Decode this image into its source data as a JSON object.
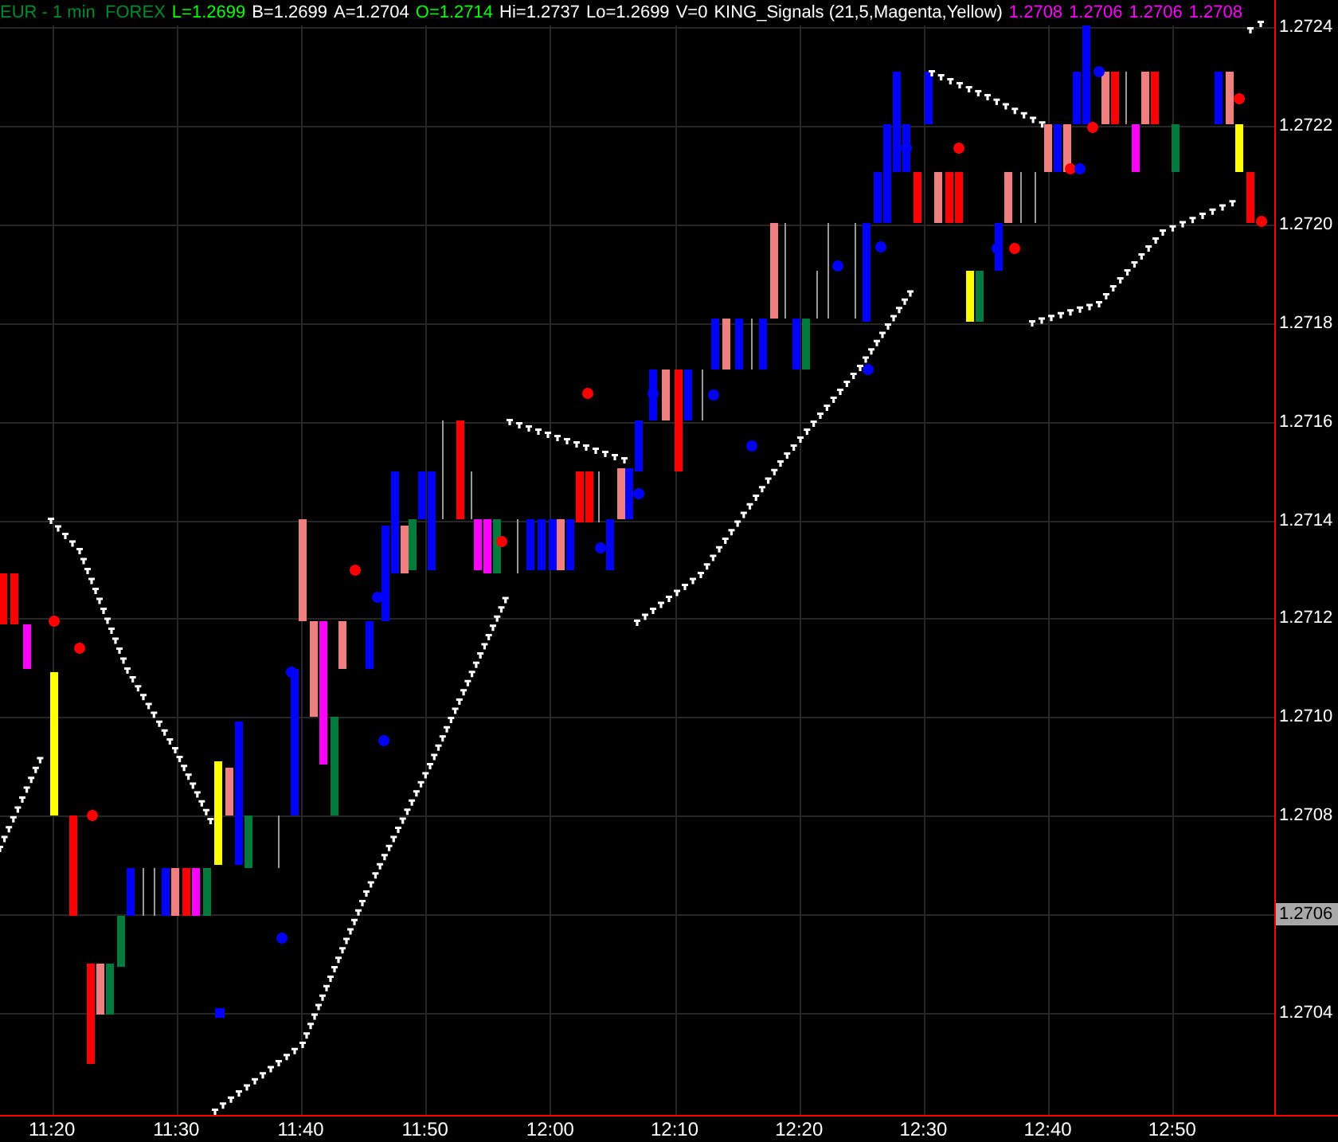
{
  "header": [
    {
      "text": "EUR - 1 min  FOREX",
      "color": "#008a2e"
    },
    {
      "text": "L=1.2699",
      "color": "#00ff00"
    },
    {
      "text": "B=1.2699",
      "color": "#ffffff"
    },
    {
      "text": "A=1.2704",
      "color": "#ffffff"
    },
    {
      "text": "O=1.2714",
      "color": "#00ff00"
    },
    {
      "text": "Hi=1.2737",
      "color": "#ffffff"
    },
    {
      "text": "Lo=1.2699",
      "color": "#ffffff"
    },
    {
      "text": "V=0",
      "color": "#ffffff"
    },
    {
      "text": "KING_Signals (21,5,Magenta,Yellow)",
      "color": "#ffffff"
    },
    {
      "text": "1.2708",
      "color": "#ff00ff"
    },
    {
      "text": "1.2706",
      "color": "#ff00ff"
    },
    {
      "text": "1.2706",
      "color": "#ff00ff"
    },
    {
      "text": "1.2708",
      "color": "#ff00ff"
    }
  ],
  "y_axis": [
    {
      "text": "1.2724",
      "kind": "tick"
    },
    {
      "text": "1.2722",
      "kind": "tick"
    },
    {
      "text": "1.2720",
      "kind": "tick"
    },
    {
      "text": "1.2718",
      "kind": "tick"
    },
    {
      "text": "1.2716",
      "kind": "tick"
    },
    {
      "text": "1.2714",
      "kind": "tick"
    },
    {
      "text": "1.2712",
      "kind": "tick"
    },
    {
      "text": "1.2710",
      "kind": "tick"
    },
    {
      "text": "1.2708",
      "kind": "tick"
    },
    {
      "text": "1.2706",
      "kind": "current"
    },
    {
      "text": "1.2704",
      "kind": "tick"
    }
  ],
  "x_axis": [
    "11:20",
    "11:30",
    "11:40",
    "11:50",
    "12:00",
    "12:10",
    "12:20",
    "12:30",
    "12:40",
    "12:50"
  ]
}
